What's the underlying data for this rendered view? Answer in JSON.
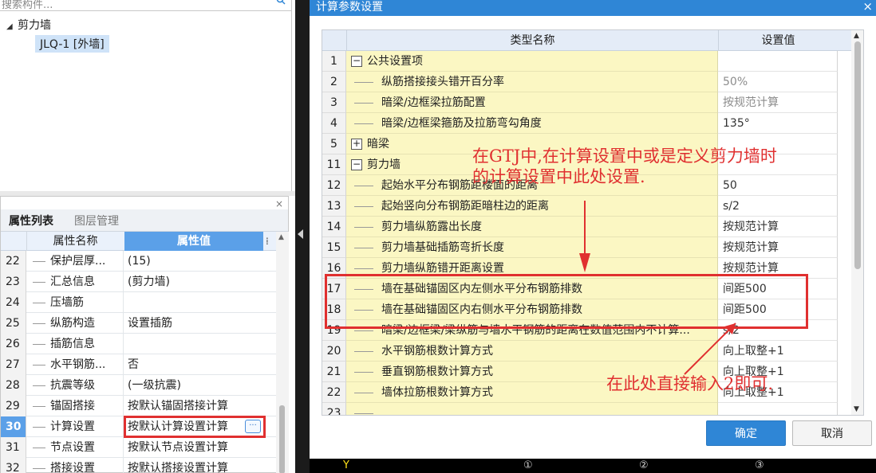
{
  "left_panel": {
    "search_placeholder": "搜索构件...",
    "tree_root_label": "剪力墙",
    "tree_child_label": "JLQ-1 [外墙]"
  },
  "property_panel": {
    "close_label": "×",
    "tabs": [
      "属性列表",
      "图层管理"
    ],
    "col_name": "属性名称",
    "col_value": "属性值",
    "rows": [
      {
        "num": "22",
        "name": "保护层厚...",
        "value": "(15)"
      },
      {
        "num": "23",
        "name": "汇总信息",
        "value": "(剪力墙)"
      },
      {
        "num": "24",
        "name": "压墙筋",
        "value": ""
      },
      {
        "num": "25",
        "name": "纵筋构造",
        "value": "设置插筋"
      },
      {
        "num": "26",
        "name": "插筋信息",
        "value": ""
      },
      {
        "num": "27",
        "name": "水平钢筋...",
        "value": "否"
      },
      {
        "num": "28",
        "name": "抗震等级",
        "value": "(一级抗震)"
      },
      {
        "num": "29",
        "name": "锚固搭接",
        "value": "按默认锚固搭接计算"
      },
      {
        "num": "30",
        "name": "计算设置",
        "value": "按默认计算设置计算",
        "selected": true
      },
      {
        "num": "31",
        "name": "节点设置",
        "value": "按默认节点设置计算"
      },
      {
        "num": "32",
        "name": "搭接设置",
        "value": "按默认搭接设置计算"
      }
    ]
  },
  "dialog": {
    "title": "计算参数设置",
    "close_label": "×",
    "col_name": "类型名称",
    "col_value": "设置值",
    "rows": [
      {
        "num": "1",
        "name": "公共设置项",
        "value": "",
        "level": 0,
        "expander": "−"
      },
      {
        "num": "2",
        "name": "纵筋搭接接头错开百分率",
        "value": "50%",
        "level": 1,
        "gray": true
      },
      {
        "num": "3",
        "name": "暗梁/边框梁拉筋配置",
        "value": "按规范计算",
        "level": 1,
        "gray": true
      },
      {
        "num": "4",
        "name": "暗梁/边框梁箍筋及拉筋弯勾角度",
        "value": "135°",
        "level": 1
      },
      {
        "num": "5",
        "name": "暗梁",
        "value": "",
        "level": 0,
        "expander": "+"
      },
      {
        "num": "11",
        "name": "剪力墙",
        "value": "",
        "level": 0,
        "expander": "−"
      },
      {
        "num": "12",
        "name": "起始水平分布钢筋距楼面的距离",
        "value": "50",
        "level": 1
      },
      {
        "num": "13",
        "name": "起始竖向分布钢筋距暗柱边的距离",
        "value": "s/2",
        "level": 1
      },
      {
        "num": "14",
        "name": "剪力墙纵筋露出长度",
        "value": "按规范计算",
        "level": 1
      },
      {
        "num": "15",
        "name": "剪力墙基础插筋弯折长度",
        "value": "按规范计算",
        "level": 1
      },
      {
        "num": "16",
        "name": "剪力墙纵筋错开距离设置",
        "value": "按规范计算",
        "level": 1
      },
      {
        "num": "17",
        "name": "墙在基础锚固区内左侧水平分布钢筋排数",
        "value": "间距500",
        "level": 1
      },
      {
        "num": "18",
        "name": "墙在基础锚固区内右侧水平分布钢筋排数",
        "value": "间距500",
        "level": 1
      },
      {
        "num": "19",
        "name": "暗梁/边框梁/梁纵筋与墙水平钢筋的距离在数值范围内不计算...",
        "value": "s/2",
        "level": 1
      },
      {
        "num": "20",
        "name": "水平钢筋根数计算方式",
        "value": "向上取整+1",
        "level": 1
      },
      {
        "num": "21",
        "name": "垂直钢筋根数计算方式",
        "value": "向上取整+1",
        "level": 1
      },
      {
        "num": "22",
        "name": "墙体拉筋根数计算方式",
        "value": "向上取整+1",
        "level": 1
      },
      {
        "num": "23",
        "name": "",
        "value": "",
        "level": 1
      }
    ],
    "ok_label": "确定",
    "cancel_label": "取消"
  },
  "axis_labels": {
    "y": "Y",
    "a1": "①",
    "a2": "②",
    "a3": "③"
  },
  "annotations": {
    "top_line1": "在GTJ中,在计算设置中或是定义剪力墙时",
    "top_line2": "的计算设置中此处设置.",
    "bottom": "在此处直接输入2即可."
  },
  "colors": {
    "accent": "#2f86d6",
    "annotation_red": "#e03030",
    "row_yellow": "#fbf7c3",
    "selected_blue": "#5ba0e8"
  }
}
